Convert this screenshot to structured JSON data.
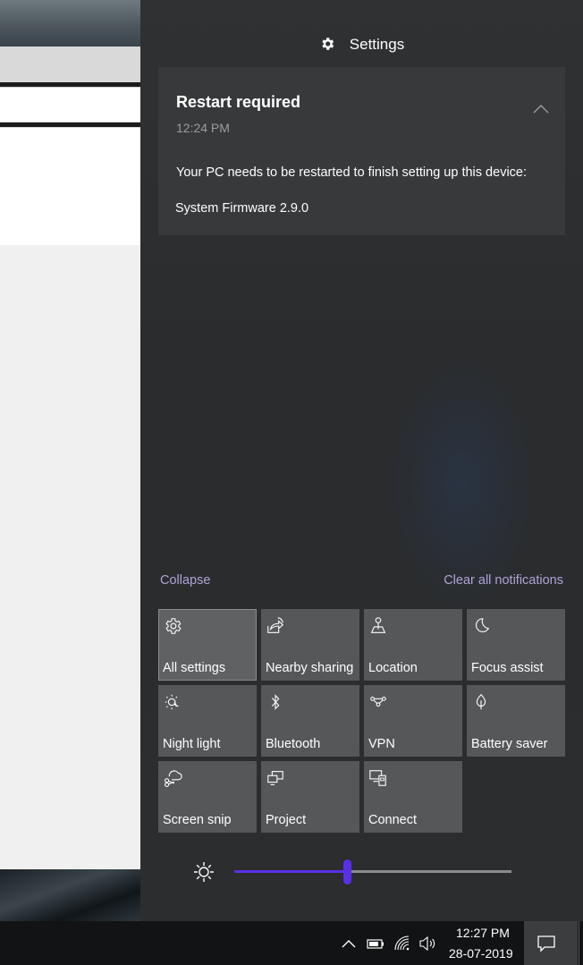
{
  "header": {
    "title": "Settings",
    "icon": "gear-icon"
  },
  "notification": {
    "title": "Restart required",
    "time": "12:24 PM",
    "body": "Your PC needs to be restarted to finish setting up this device:",
    "detail": "System Firmware 2.9.0"
  },
  "links": {
    "collapse": "Collapse",
    "clear_all": "Clear all notifications"
  },
  "quick_actions": [
    {
      "label": "All settings",
      "icon": "gear-icon"
    },
    {
      "label": "Nearby sharing",
      "icon": "nearby-sharing-icon"
    },
    {
      "label": "Location",
      "icon": "location-icon"
    },
    {
      "label": "Focus assist",
      "icon": "moon-icon"
    },
    {
      "label": "Night light",
      "icon": "night-light-icon"
    },
    {
      "label": "Bluetooth",
      "icon": "bluetooth-icon"
    },
    {
      "label": "VPN",
      "icon": "vpn-icon"
    },
    {
      "label": "Battery saver",
      "icon": "battery-saver-icon"
    },
    {
      "label": "Screen snip",
      "icon": "scissors-icon"
    },
    {
      "label": "Project",
      "icon": "project-icon"
    },
    {
      "label": "Connect",
      "icon": "connect-icon"
    }
  ],
  "brightness": {
    "level": 0.405,
    "icon": "sun-icon"
  },
  "taskbar": {
    "time": "12:27 PM",
    "date": "28-07-2019"
  },
  "colors": {
    "accent": "#5b2fe8",
    "link": "#b1a3d6",
    "panel": "#2b2d2f",
    "tile": "#555759"
  }
}
